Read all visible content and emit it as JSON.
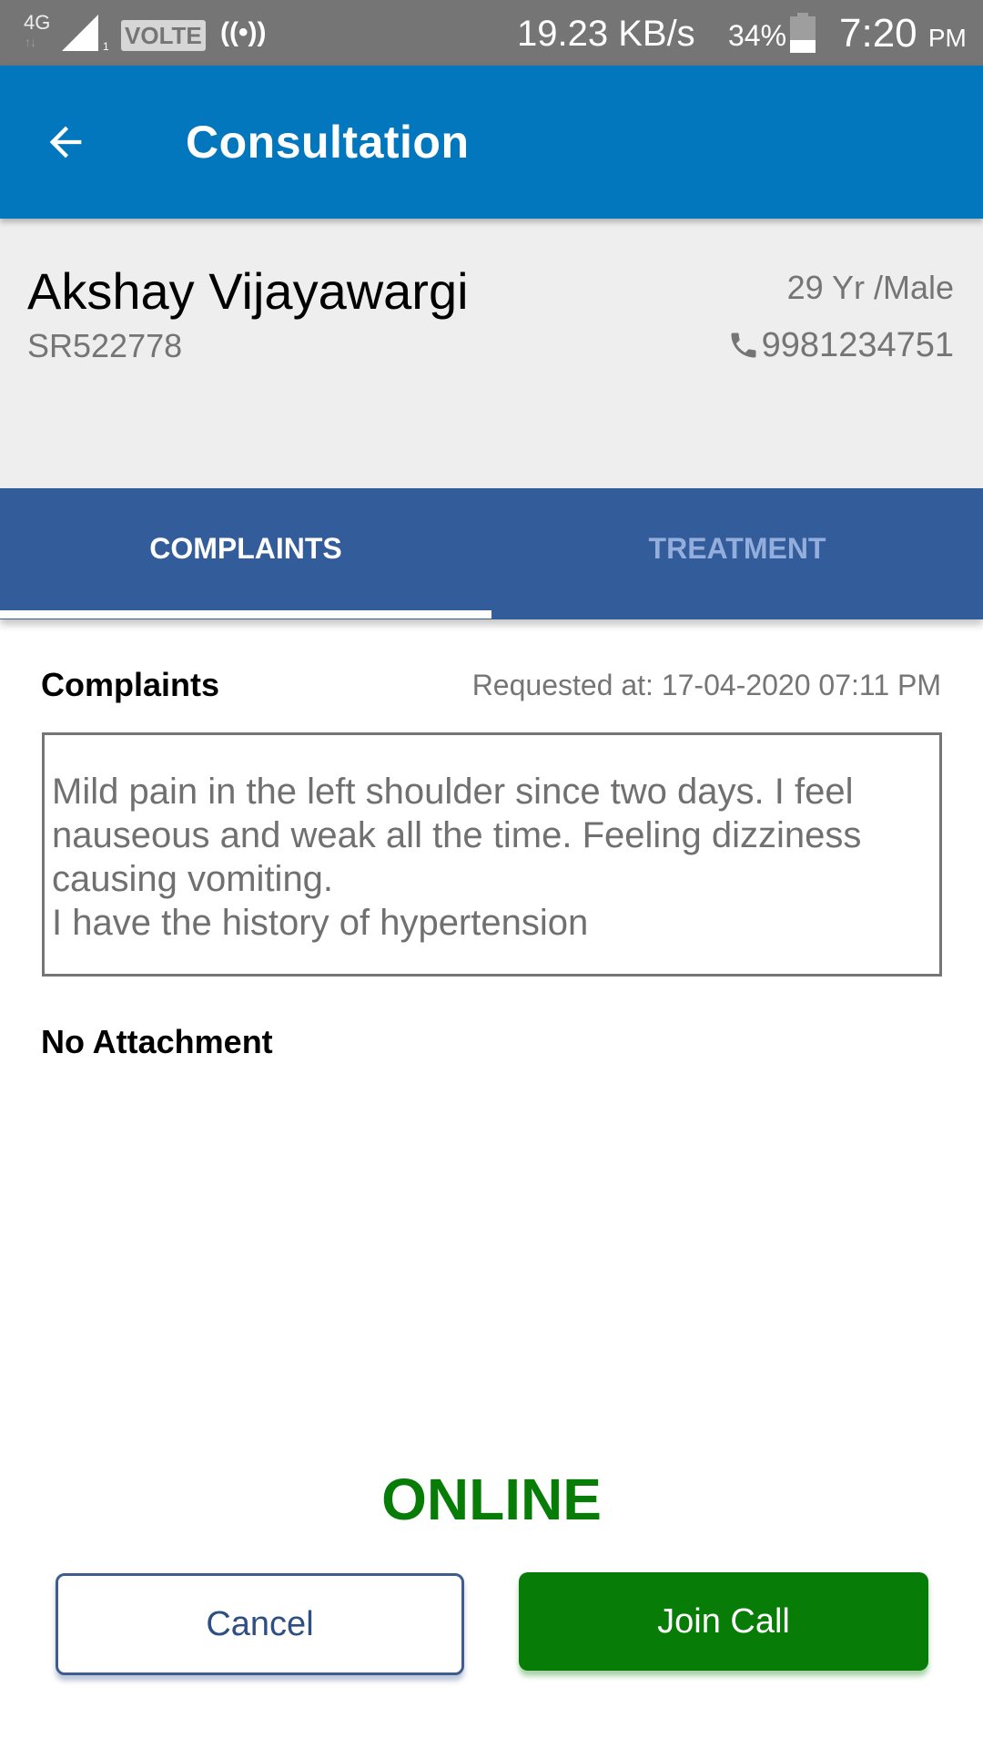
{
  "status_bar": {
    "network_type": "4G",
    "network_arrows": "↑↓",
    "sim_slot": "1",
    "volte": "VOLTE",
    "hotspot_icon": "hotspot-icon",
    "data_speed": "19.23 KB/s",
    "battery_percent": "34%",
    "battery_level": 0.34,
    "time": "7:20",
    "ampm": "PM"
  },
  "app_bar": {
    "back_icon": "arrow-left-icon",
    "title": "Consultation"
  },
  "patient": {
    "name": "Akshay Vijayawargi",
    "id": "SR522778",
    "age_gender": "29 Yr /Male",
    "phone_icon": "phone-icon",
    "phone": "9981234751"
  },
  "tabs": [
    {
      "label": "COMPLAINTS",
      "active": true
    },
    {
      "label": "TREATMENT",
      "active": false
    }
  ],
  "complaints": {
    "title": "Complaints",
    "requested_at": "Requested at: 17-04-2020 07:11 PM",
    "text": "Mild pain in the left shoulder since two days. I feel nauseous and weak all the time. Feeling dizziness causing vomiting.\nI have the history of hypertension",
    "attachment_status": "No Attachment"
  },
  "call": {
    "status": "ONLINE",
    "cancel_label": "Cancel",
    "join_label": "Join Call"
  },
  "colors": {
    "app_bar": "#0277BD",
    "tabs_bg": "#335C9A",
    "online_green": "#077D07",
    "cancel_border": "#3E5C8E"
  }
}
